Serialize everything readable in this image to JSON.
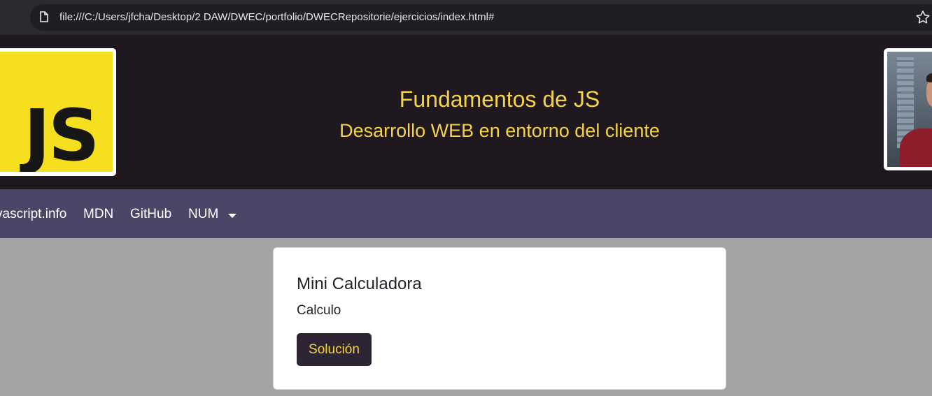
{
  "browser": {
    "url": "file:///C:/Users/jfcha/Desktop/2 DAW/DWEC/portfolio/DWECRepositorie/ejercicios/index.html#"
  },
  "header": {
    "logo_text": "JS",
    "title": "Fundamentos de JS",
    "subtitle": "Desarrollo WEB en entorno del cliente"
  },
  "navbar": {
    "links": [
      "vascript.info",
      "MDN",
      "GitHub",
      "NUM"
    ]
  },
  "card": {
    "title": "Mini Calculadora",
    "text": "Calculo",
    "button_label": "Solución"
  },
  "colors": {
    "header_bg": "#1f181f",
    "accent_yellow": "#f5d344",
    "navbar_bg": "#4b4668",
    "page_bg": "#a4a3a4",
    "button_bg": "#2e2534",
    "js_logo_yellow": "#f6df1e"
  }
}
